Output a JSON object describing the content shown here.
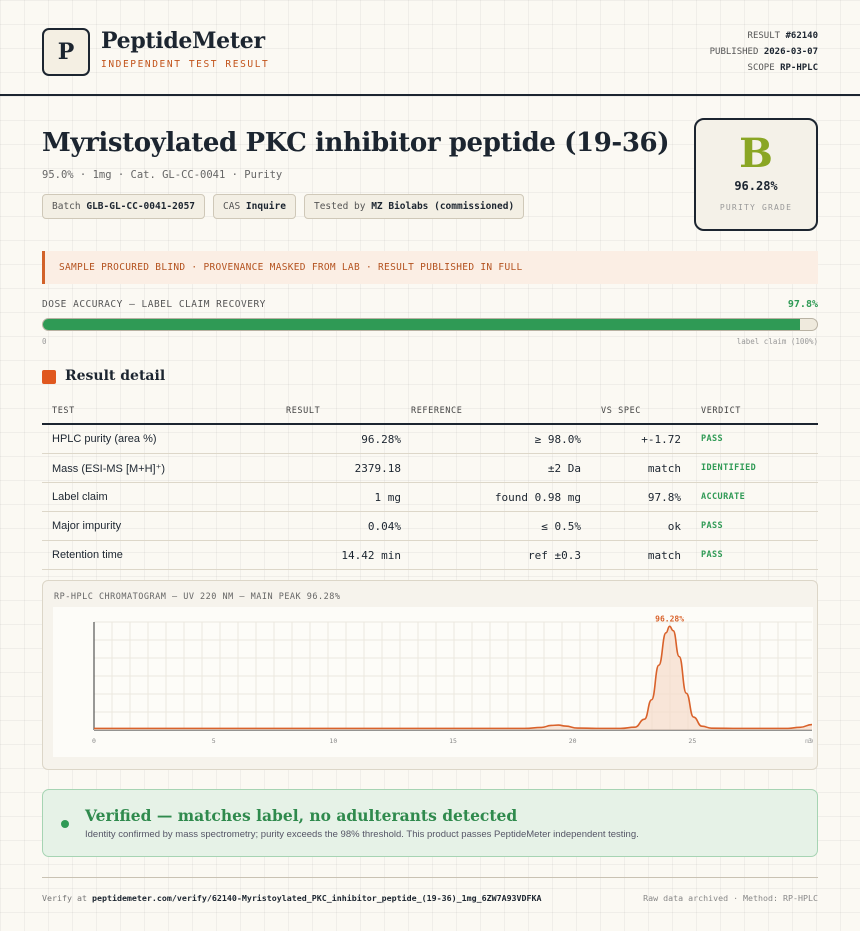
{
  "brand": {
    "logo_letter": "P",
    "name": "PeptideMeter",
    "tagline": "INDEPENDENT TEST RESULT"
  },
  "meta": {
    "result_label": "RESULT",
    "result_value": "#62140",
    "published_label": "PUBLISHED",
    "published_value": "2026-03-07",
    "scope_label": "SCOPE",
    "scope_value": "RP-HPLC"
  },
  "product": {
    "title": "Myristoylated PKC inhibitor peptide (19-36)",
    "subline": "95.0% · 1mg · Cat. GL-CC-0041 · Purity",
    "chips": [
      {
        "label": "Batch",
        "value": "GLB-GL-CC-0041-2057"
      },
      {
        "label": "CAS",
        "value": "Inquire"
      },
      {
        "label": "Tested by",
        "value": "MZ Biolabs (commissioned)"
      }
    ]
  },
  "grade": {
    "letter": "B",
    "value": "96.28%",
    "label": "PURITY GRADE",
    "color": "#8aa624"
  },
  "notice": "SAMPLE PROCURED BLIND · PROVENANCE MASKED FROM LAB · RESULT PUBLISHED IN FULL",
  "dose": {
    "label": "DOSE ACCURACY — LABEL CLAIM RECOVERY",
    "percent_text": "97.8%",
    "fill_fraction": 0.978,
    "left_label": "0",
    "right_label": "label claim (100%)"
  },
  "results": {
    "title": "Result detail",
    "headers": [
      "TEST",
      "RESULT",
      "REFERENCE",
      "VS SPEC",
      "VERDICT"
    ],
    "rows": [
      {
        "test": "HPLC purity (area %)",
        "result": "96.28%",
        "reference": "≥ 98.0%",
        "vs_spec": "+-1.72",
        "verdict": "PASS"
      },
      {
        "test": "Mass (ESI-MS [M+H]⁺)",
        "result": "2379.18",
        "reference": "±2 Da",
        "vs_spec": "match",
        "verdict": "IDENTIFIED"
      },
      {
        "test": "Label claim",
        "result": "1 mg",
        "reference": "found 0.98 mg",
        "vs_spec": "97.8%",
        "verdict": "ACCURATE"
      },
      {
        "test": "Major impurity",
        "result": "0.04%",
        "reference": "≤ 0.5%",
        "vs_spec": "ok",
        "verdict": "PASS"
      },
      {
        "test": "Retention time",
        "result": "14.42 min",
        "reference": "ref ±0.3",
        "vs_spec": "match",
        "verdict": "PASS"
      }
    ]
  },
  "chart_data": {
    "type": "line",
    "title": "RP-HPLC CHROMATOGRAM — UV 220 NM — MAIN PEAK 96.28%",
    "xlabel": "",
    "ylabel": "",
    "x_ticks": [
      "0",
      "5",
      "10",
      "15",
      "20",
      "25",
      "30"
    ],
    "x_tick_values": [
      0,
      5,
      10,
      15,
      20,
      25,
      30
    ],
    "unit_label": "min",
    "xlim": [
      0,
      30
    ],
    "ylim": [
      0,
      100
    ],
    "peak_label": "96.28%",
    "series": [
      {
        "color": "#d9622b",
        "fill": "#f5dccb",
        "points": [
          [
            0,
            1.5
          ],
          [
            5,
            1.5
          ],
          [
            10,
            1.5
          ],
          [
            15,
            1.5
          ],
          [
            18,
            1.5
          ],
          [
            18.7,
            2.4
          ],
          [
            19.1,
            4.2
          ],
          [
            19.4,
            4.6
          ],
          [
            19.7,
            3.6
          ],
          [
            20.2,
            1.8
          ],
          [
            21,
            1.5
          ],
          [
            22,
            1.5
          ],
          [
            22.6,
            2.6
          ],
          [
            23.0,
            10
          ],
          [
            23.3,
            28
          ],
          [
            23.6,
            60
          ],
          [
            23.9,
            90
          ],
          [
            24.05,
            96
          ],
          [
            24.2,
            92
          ],
          [
            24.45,
            68
          ],
          [
            24.75,
            34
          ],
          [
            25.05,
            12
          ],
          [
            25.4,
            3.5
          ],
          [
            25.8,
            1.7
          ],
          [
            27,
            1.5
          ],
          [
            29,
            1.5
          ],
          [
            29.5,
            2.5
          ],
          [
            30,
            5
          ]
        ]
      }
    ],
    "grid": true
  },
  "verified": {
    "title": "Verified — matches label, no adulterants detected",
    "text": "Identity confirmed by mass spectrometry; purity exceeds the 98% threshold. This product passes PeptideMeter independent testing."
  },
  "footer": {
    "verify_prefix": "Verify at",
    "verify_url": "peptidemeter.com/verify/62140-Myristoylated_PKC_inhibitor_peptide_(19-36)_1mg_6ZW7A93VDFKA",
    "right_text": "Raw data archived · Method: RP-HPLC"
  }
}
